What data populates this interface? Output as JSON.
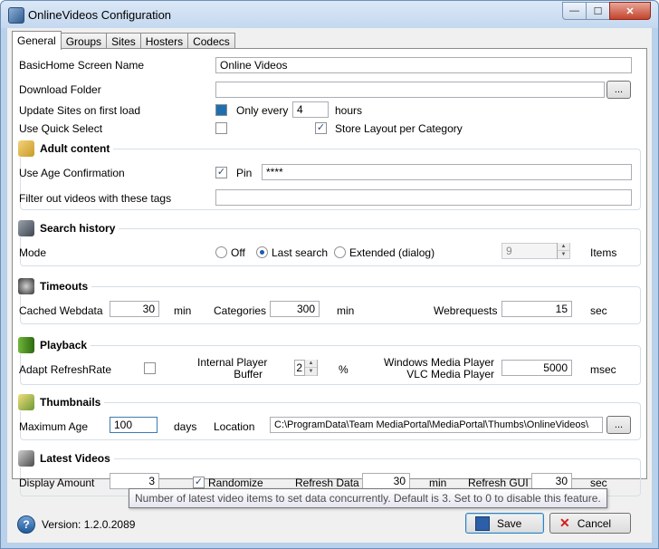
{
  "window": {
    "title": "OnlineVideos Configuration",
    "min": "—",
    "max": "☐",
    "close": "✕"
  },
  "tabs": [
    "General",
    "Groups",
    "Sites",
    "Hosters",
    "Codecs"
  ],
  "general": {
    "home_label": "BasicHome Screen Name",
    "home_value": "Online Videos",
    "download_label": "Download Folder",
    "download_value": "",
    "browse": "...",
    "update_label": "Update Sites on first load",
    "only_every": "Only every",
    "only_every_value": "4",
    "hours": "hours",
    "quick_label": "Use Quick Select",
    "store_layout": "Store Layout per Category"
  },
  "adult": {
    "title": "Adult content",
    "age_label": "Use Age Confirmation",
    "pin": "Pin",
    "pin_value": "****",
    "filter_label": "Filter out videos with these tags",
    "filter_value": ""
  },
  "search": {
    "title": "Search history",
    "mode_label": "Mode",
    "off": "Off",
    "last": "Last search",
    "extended": "Extended (dialog)",
    "items_value": "9",
    "items": "Items"
  },
  "timeouts": {
    "title": "Timeouts",
    "cached_label": "Cached Webdata",
    "cached_value": "30",
    "min": "min",
    "categories_label": "Categories",
    "categories_value": "300",
    "min2": "min",
    "webreq_label": "Webrequests",
    "webreq_value": "15",
    "sec": "sec"
  },
  "playback": {
    "title": "Playback",
    "adapt_label": "Adapt RefreshRate",
    "buffer_l1": "Internal Player",
    "buffer_l2": "Buffer",
    "buffer_value": "2",
    "percent": "%",
    "wmp_l1": "Windows Media Player",
    "wmp_l2": "VLC Media Player",
    "wmp_value": "5000",
    "msec": "msec"
  },
  "thumbs": {
    "title": "Thumbnails",
    "age_label": "Maximum Age",
    "age_value": "100",
    "days": "days",
    "location_label": "Location",
    "location_value": "C:\\ProgramData\\Team MediaPortal\\MediaPortal\\Thumbs\\OnlineVideos\\",
    "browse": "..."
  },
  "latest": {
    "title": "Latest Videos",
    "display_label": "Display Amount",
    "display_value": "3",
    "randomize": "Randomize",
    "refresh_label": "Refresh Data",
    "refresh_value": "30",
    "min": "min",
    "gui_label": "Refresh GUI",
    "gui_value": "30",
    "sec": "sec"
  },
  "tooltip": "Number of latest video items to set data concurrently. Default is 3. Set to 0 to disable this feature.",
  "footer": {
    "help_icon": "?",
    "version": "Version: 1.2.0.2089",
    "save": "Save",
    "cancel": "Cancel"
  },
  "checks": {
    "check_mark": "✓",
    "cancel_mark": "✕",
    "spin_up": "▲",
    "spin_down": "▼"
  },
  "colors": {
    "accent": "#1f6fb0",
    "section_border": "#d5dfe5"
  },
  "icons": [
    "app-icon",
    "key-icon",
    "binoculars-icon",
    "stopwatch-icon",
    "battery-icon",
    "image-icon",
    "film-icon",
    "help-icon",
    "save-icon",
    "cancel-icon"
  ]
}
